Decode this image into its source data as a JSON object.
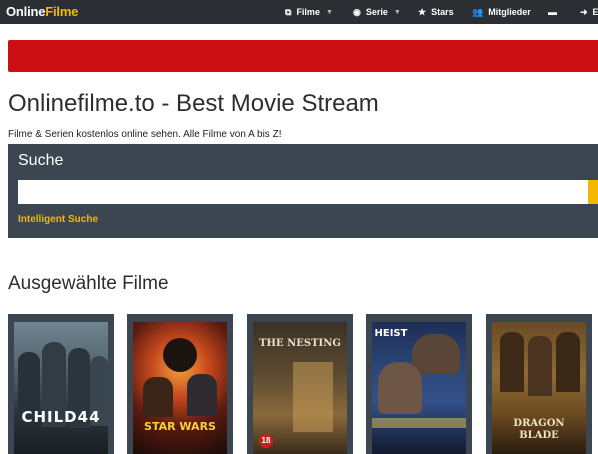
{
  "brand": {
    "part1": "Online",
    "part2": "Filme"
  },
  "nav": {
    "filme": "Filme",
    "serie": "Serie",
    "stars": "Stars",
    "mitglieder": "Mitglieder",
    "last": "E"
  },
  "page": {
    "title": "Onlinefilme.to - Best Movie Stream",
    "subtitle": "Filme & Serien kostenlos online sehen. Alle Filme von A bis Z!"
  },
  "search": {
    "label": "Suche",
    "value": "",
    "placeholder": "",
    "smart_link": "Intelligent Suche"
  },
  "featured": {
    "title": "Ausgewählte Filme",
    "posters": [
      {
        "title_text": "CHILD44"
      },
      {
        "title_text": "STAR WARS"
      },
      {
        "title_text": "THE NESTING"
      },
      {
        "title_text": "HEIST"
      },
      {
        "title_text": "DRAGON BLADE"
      }
    ]
  },
  "colors": {
    "topbar": "#2b2f33",
    "accent": "#f5b800",
    "banner": "#cc0f12",
    "panel": "#3b4650"
  }
}
